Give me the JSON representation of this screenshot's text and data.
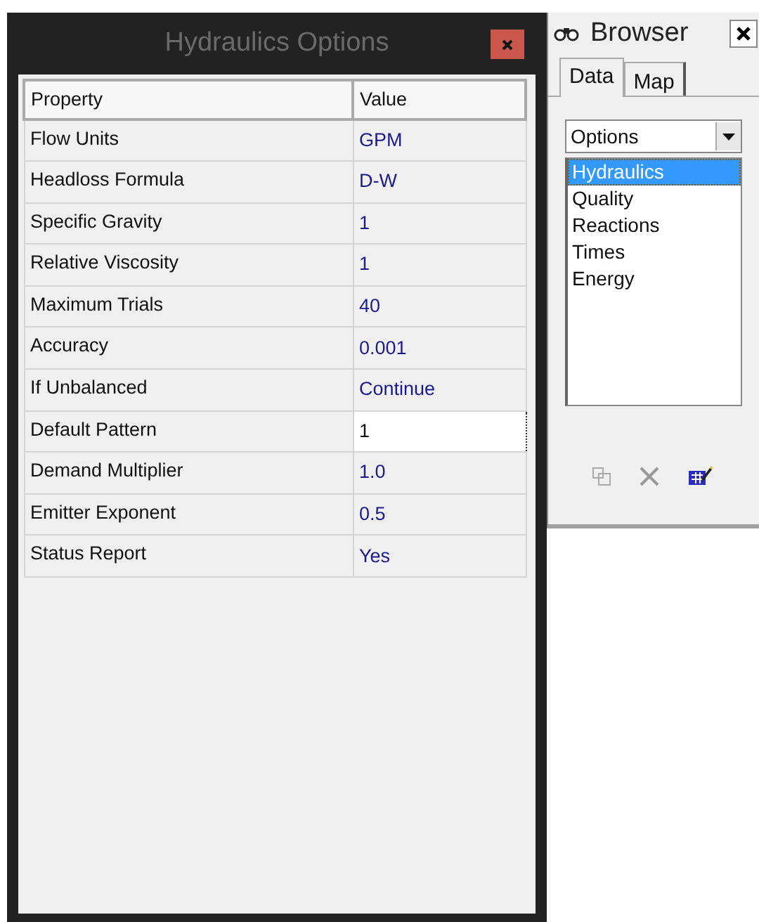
{
  "options_window": {
    "title": "Hydraulics Options",
    "columns": [
      "Property",
      "Value"
    ],
    "rows": [
      {
        "property": "Flow Units",
        "value": "GPM",
        "editing": false
      },
      {
        "property": "Headloss Formula",
        "value": "D-W",
        "editing": false
      },
      {
        "property": "Specific Gravity",
        "value": "1",
        "editing": false
      },
      {
        "property": "Relative Viscosity",
        "value": "1",
        "editing": false
      },
      {
        "property": "Maximum Trials",
        "value": "40",
        "editing": false
      },
      {
        "property": "Accuracy",
        "value": "0.001",
        "editing": false
      },
      {
        "property": "If Unbalanced",
        "value": "Continue",
        "editing": false
      },
      {
        "property": "Default Pattern",
        "value": "1",
        "editing": true
      },
      {
        "property": "Demand Multiplier",
        "value": "1.0",
        "editing": false
      },
      {
        "property": "Emitter Exponent",
        "value": "0.5",
        "editing": false
      },
      {
        "property": "Status Report",
        "value": "Yes",
        "editing": false
      }
    ]
  },
  "browser": {
    "title": "Browser",
    "tabs": [
      {
        "label": "Data",
        "selected": true
      },
      {
        "label": "Map",
        "selected": false
      }
    ],
    "category": "Options",
    "items": [
      {
        "label": "Hydraulics",
        "selected": true
      },
      {
        "label": "Quality",
        "selected": false
      },
      {
        "label": "Reactions",
        "selected": false
      },
      {
        "label": "Times",
        "selected": false
      },
      {
        "label": "Energy",
        "selected": false
      }
    ]
  }
}
